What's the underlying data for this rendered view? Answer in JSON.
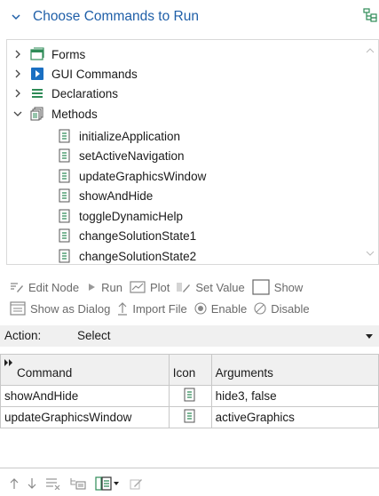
{
  "header": {
    "title": "Choose Commands to Run"
  },
  "tree": {
    "items": [
      {
        "label": "Forms"
      },
      {
        "label": "GUI Commands"
      },
      {
        "label": "Declarations"
      },
      {
        "label": "Methods"
      },
      {
        "label": "initializeApplication"
      },
      {
        "label": "setActiveNavigation"
      },
      {
        "label": "updateGraphicsWindow"
      },
      {
        "label": "showAndHide"
      },
      {
        "label": "toggleDynamicHelp"
      },
      {
        "label": "changeSolutionState1"
      },
      {
        "label": "changeSolutionState2"
      }
    ]
  },
  "toolbar": {
    "edit_node": "Edit Node",
    "run": "Run",
    "plot": "Plot",
    "set_value": "Set Value",
    "show": "Show",
    "show_as_dialog": "Show as Dialog",
    "import_file": "Import File",
    "enable": "Enable",
    "disable": "Disable"
  },
  "action": {
    "label": "Action:",
    "value": "Select"
  },
  "table": {
    "headers": [
      "Command",
      "Icon",
      "Arguments"
    ],
    "rows": [
      {
        "command": "showAndHide",
        "arguments": "hide3, false"
      },
      {
        "command": "updateGraphicsWindow",
        "arguments": "activeGraphics"
      }
    ]
  },
  "colors": {
    "title": "#1f5fa8",
    "gui_icon": "#1a6fc2",
    "enable_icon": "#2e8b57"
  }
}
